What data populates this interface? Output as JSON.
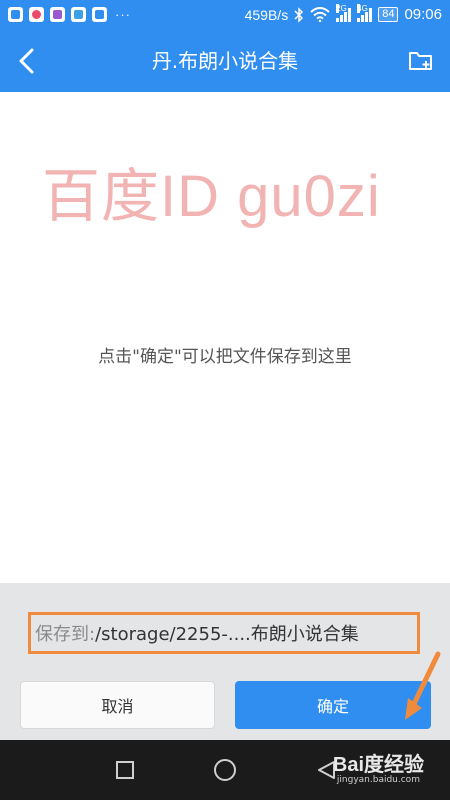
{
  "status_bar": {
    "network_speed": "459B/s",
    "signal_1_tag": "2G",
    "signal_2_tag": "4G",
    "battery": "84",
    "time": "09:06",
    "more": "···"
  },
  "header": {
    "title": "丹.布朗小说合集",
    "back_icon": "chevron-left-icon",
    "action_icon": "new-folder-icon"
  },
  "watermark": "百度ID gu0zi",
  "hint": "点击\"确定\"可以把文件保存到这里",
  "save_path": {
    "label": "保存到:",
    "value": "/storage/2255-....布朗小说合集"
  },
  "buttons": {
    "cancel": "取消",
    "ok": "确定"
  },
  "brand": {
    "logo_text": "Bai度经验",
    "url": "jingyan.baidu.com"
  },
  "colors": {
    "primary": "#2f8ef0",
    "highlight": "#f08a3c",
    "watermark": "#f2b3b3"
  }
}
